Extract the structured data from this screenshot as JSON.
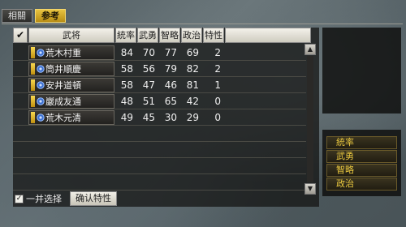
{
  "tabs": [
    {
      "label": "相關",
      "active": false
    },
    {
      "label": "参考",
      "active": true
    }
  ],
  "header": {
    "check_mark": "✔",
    "name": "武将",
    "stats": [
      "統率",
      "武勇",
      "智略",
      "政治",
      "特性"
    ]
  },
  "rows": [
    {
      "name": "荒木村重",
      "values": [
        "84",
        "70",
        "77",
        "69",
        "2"
      ]
    },
    {
      "name": "筒井順慶",
      "values": [
        "58",
        "56",
        "79",
        "82",
        "2"
      ]
    },
    {
      "name": "安井道頓",
      "values": [
        "58",
        "47",
        "46",
        "81",
        "1"
      ]
    },
    {
      "name": "巖成友通",
      "values": [
        "48",
        "51",
        "65",
        "42",
        "0"
      ]
    },
    {
      "name": "荒木元清",
      "values": [
        "49",
        "45",
        "30",
        "29",
        "0"
      ]
    }
  ],
  "scroll": {
    "up": "▲",
    "down": "▼"
  },
  "bottom": {
    "select_all_label": "一并选择",
    "select_all_checked": "☑",
    "confirm_label": "确认特性"
  },
  "side_items": [
    "統率",
    "武勇",
    "智略",
    "政治"
  ],
  "colors": {
    "accent": "#e8c440",
    "side_text": "#eac83f"
  }
}
